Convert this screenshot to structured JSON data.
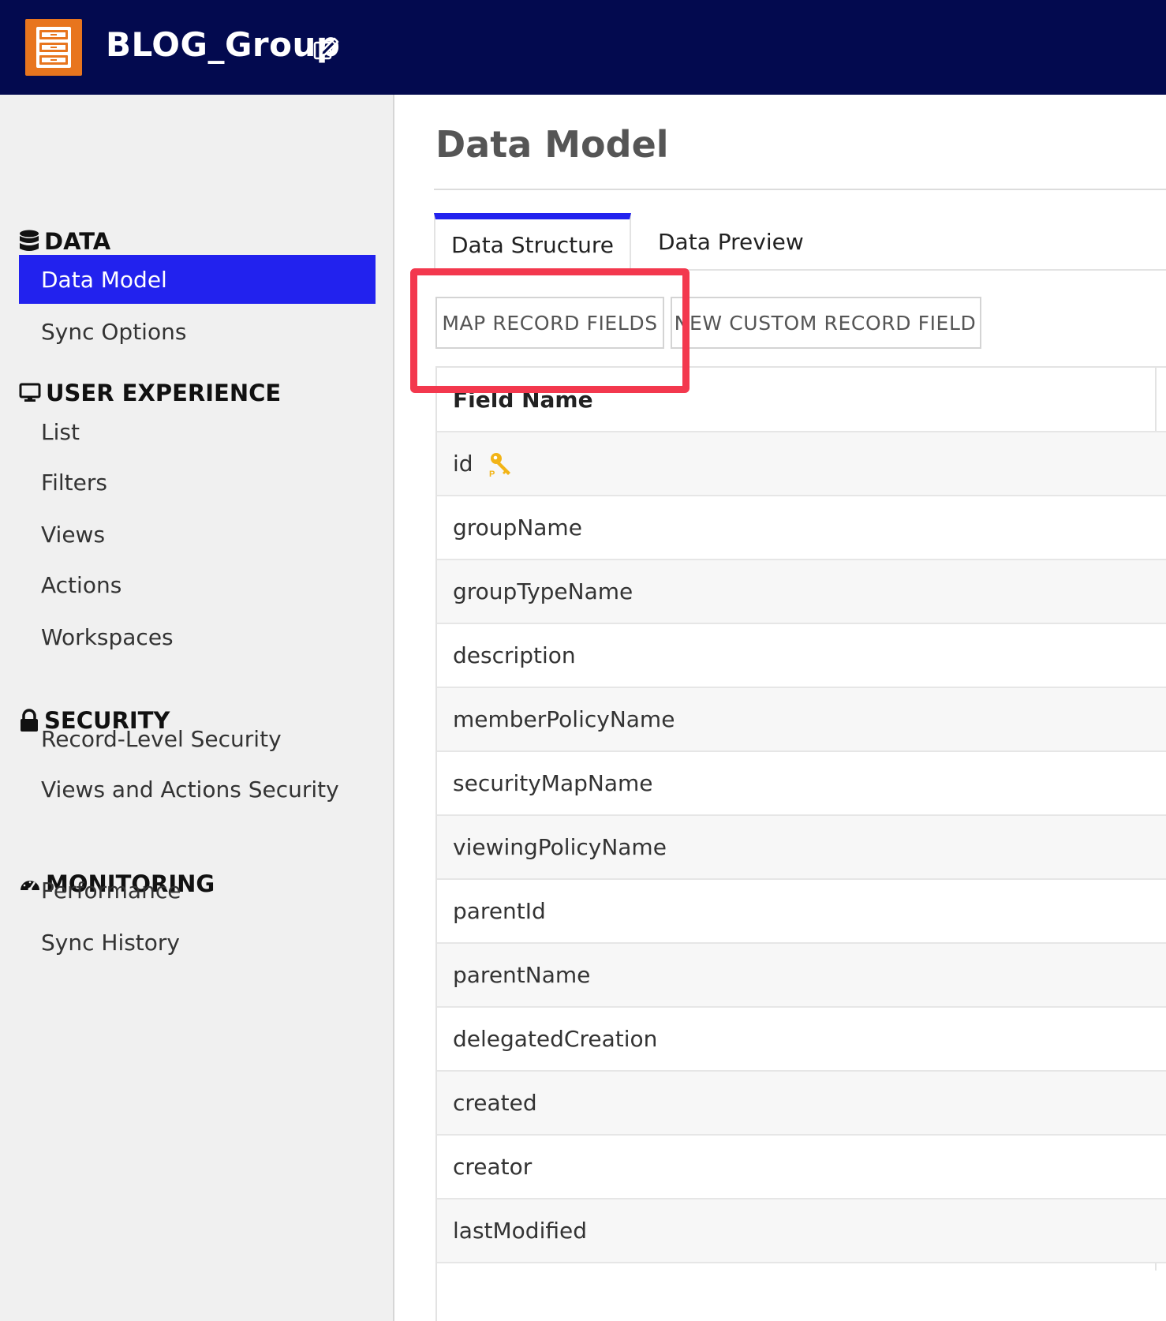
{
  "header": {
    "app_title": "BLOG_Group",
    "app_icon": "file-cabinet-icon",
    "edit_icon": "edit-external-icon",
    "background": "#030a4f",
    "icon_color": "#e8751e"
  },
  "sidebar": {
    "sections": [
      {
        "title": "DATA",
        "icon": "database-icon"
      },
      {
        "title": "USER EXPERIENCE",
        "icon": "monitor-icon"
      },
      {
        "title": "SECURITY",
        "icon": "lock-icon"
      },
      {
        "title": "MONITORING",
        "icon": "gauge-icon"
      }
    ],
    "items": {
      "data_model": "Data Model",
      "sync_options": "Sync Options",
      "list": "List",
      "filters": "Filters",
      "views": "Views",
      "actions": "Actions",
      "workspaces": "Workspaces",
      "record_level_security": "Record-Level Security",
      "views_actions_security": "Views and Actions Security",
      "performance": "Performance",
      "sync_history": "Sync History"
    },
    "active_item": "Data Model",
    "active_color": "#2222ee"
  },
  "main": {
    "page_title": "Data Model",
    "tabs": [
      {
        "label": "Data Structure",
        "active": true
      },
      {
        "label": "Data Preview",
        "active": false
      }
    ],
    "buttons": {
      "map_record_fields": "MAP RECORD FIELDS",
      "new_custom_record_field": "NEW CUSTOM RECORD FIELD"
    },
    "highlight_color": "#f3384e",
    "table": {
      "header": "Field Name",
      "rows": [
        {
          "name": "id",
          "primary_key": true
        },
        {
          "name": "groupName"
        },
        {
          "name": "groupTypeName"
        },
        {
          "name": "description"
        },
        {
          "name": "memberPolicyName"
        },
        {
          "name": "securityMapName"
        },
        {
          "name": "viewingPolicyName"
        },
        {
          "name": "parentId"
        },
        {
          "name": "parentName"
        },
        {
          "name": "delegatedCreation"
        },
        {
          "name": "created"
        },
        {
          "name": "creator"
        },
        {
          "name": "lastModified"
        }
      ],
      "primary_key_icon": "primary-key-icon"
    }
  }
}
